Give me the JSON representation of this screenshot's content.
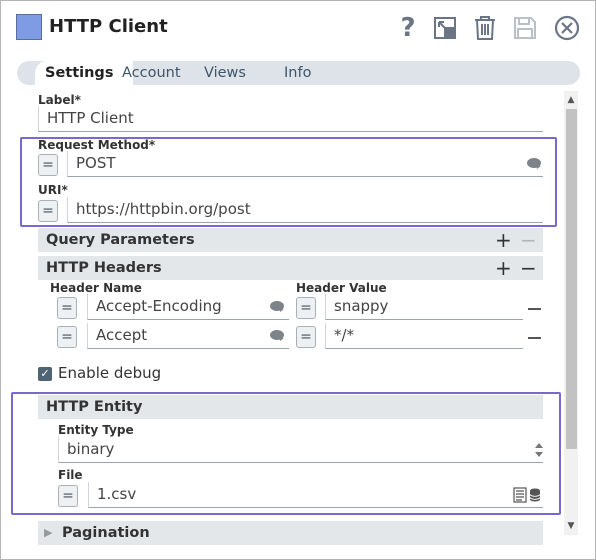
{
  "header": {
    "title": "HTTP Client",
    "icons": [
      "help-icon",
      "export-icon",
      "delete-icon",
      "save-icon",
      "close-icon"
    ],
    "help_glyph": "?",
    "swatch_color": "#7e9be3"
  },
  "tabs": [
    {
      "label": "Settings",
      "active": true
    },
    {
      "label": "Account",
      "active": false
    },
    {
      "label": "Views",
      "active": false
    },
    {
      "label": "Info",
      "active": false
    }
  ],
  "fields": {
    "label": {
      "label": "Label*",
      "value": "HTTP Client"
    },
    "request_method": {
      "label": "Request Method*",
      "value": "POST",
      "expr_button": "="
    },
    "uri": {
      "label": "URI*",
      "value": "https://httpbin.org/post",
      "expr_button": "="
    }
  },
  "query_parameters": {
    "title": "Query Parameters",
    "add": "+",
    "remove": "−"
  },
  "http_headers": {
    "title": "HTTP Headers",
    "add": "+",
    "remove": "−",
    "columns": [
      "Header Name",
      "Header Value"
    ],
    "rows": [
      {
        "name": "Accept-Encoding",
        "value": "snappy",
        "expr_button": "="
      },
      {
        "name": "Accept",
        "value": "*/*",
        "expr_button": "="
      }
    ]
  },
  "enable_debug": {
    "label": "Enable debug",
    "checked": true,
    "check_glyph": "✓"
  },
  "http_entity": {
    "title": "HTTP Entity",
    "entity_type": {
      "label": "Entity Type",
      "value": "binary"
    },
    "file": {
      "label": "File",
      "value": "1.csv",
      "expr_button": "="
    }
  },
  "pagination": {
    "title": "Pagination"
  },
  "accent_color": "#7a68d2"
}
